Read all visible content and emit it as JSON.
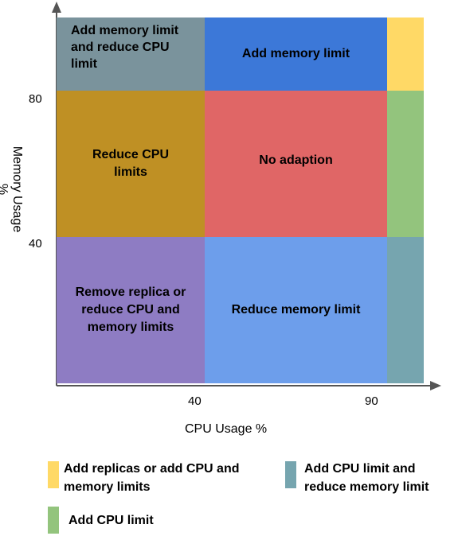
{
  "axes": {
    "x_title": "CPU Usage %",
    "y_title": "Memory Usage %",
    "x_ticks": [
      "40",
      "90"
    ],
    "y_ticks": [
      "80",
      "40"
    ]
  },
  "regions": {
    "top_left": {
      "label": "Add memory limit and reduce CPU limit",
      "color": "#7a939c"
    },
    "top_mid": {
      "label": "Add memory limit",
      "color": "#3c78d8"
    },
    "top_right": {
      "label": "",
      "color": "#ffd966"
    },
    "mid_left": {
      "label": "Reduce CPU limits",
      "color": "#bf9024"
    },
    "mid_mid": {
      "label": "No adaption",
      "color": "#e06666"
    },
    "mid_right": {
      "label": "",
      "color": "#93c47d"
    },
    "bot_left": {
      "label": "Remove replica or reduce CPU and memory limits",
      "color": "#8e7cc3"
    },
    "bot_mid": {
      "label": "Reduce memory limit",
      "color": "#6d9eeb"
    },
    "bot_right": {
      "label": "",
      "color": "#76a5af"
    }
  },
  "legend": [
    {
      "label": "Add replicas or add CPU and memory limits",
      "color": "#ffd966"
    },
    {
      "label": "Add CPU limit and reduce memory limit",
      "color": "#76a5af"
    },
    {
      "label": "Add CPU limit",
      "color": "#93c47d"
    }
  ]
}
